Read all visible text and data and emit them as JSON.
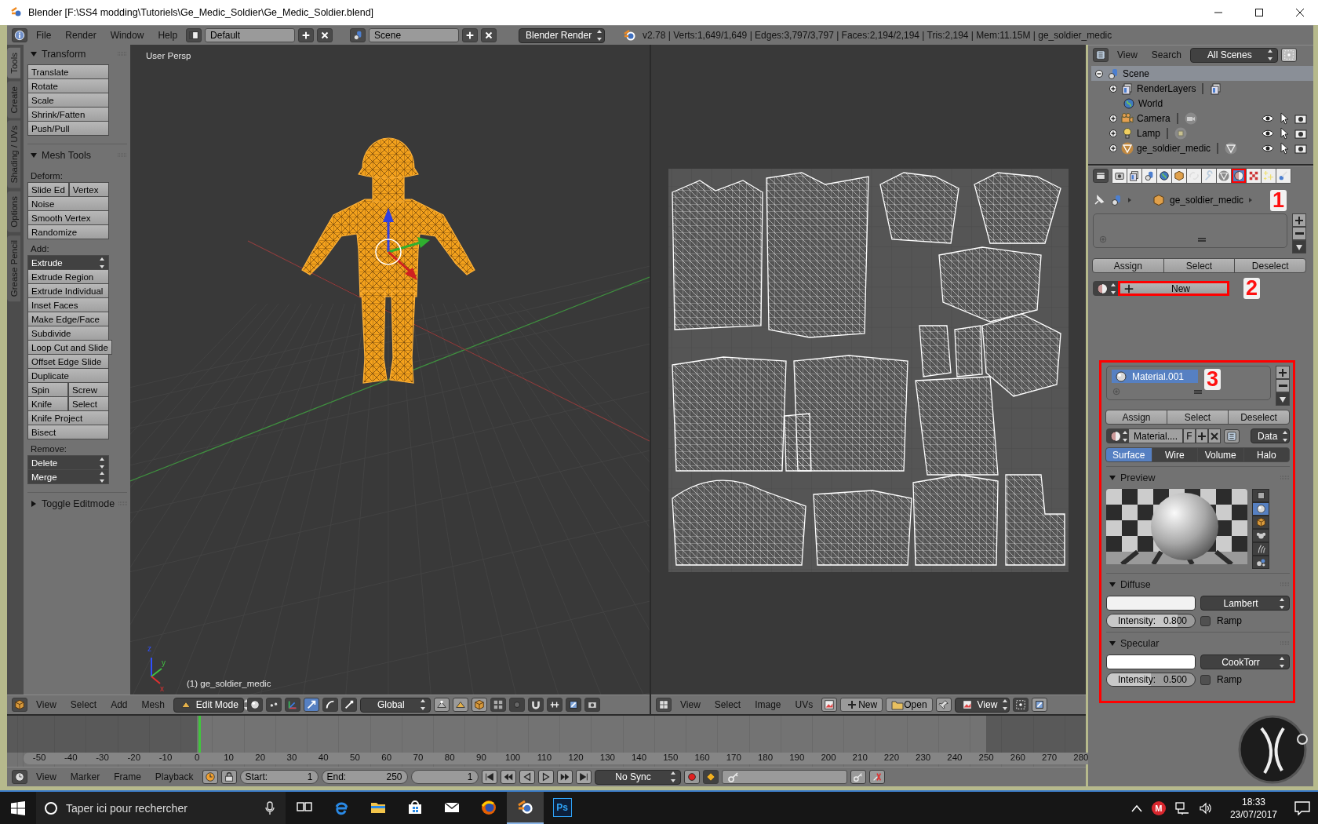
{
  "window": {
    "title": "Blender [F:\\SS4 modding\\Tutoriels\\Ge_Medic_Soldier\\Ge_Medic_Soldier.blend]"
  },
  "info_header": {
    "menus": [
      "File",
      "Render",
      "Window",
      "Help"
    ],
    "screen_layout": "Default",
    "scene": "Scene",
    "render_engine": "Blender Render",
    "stats": "v2.78 | Verts:1,649/1,649 | Edges:3,797/3,797 | Faces:2,194/2,194 | Tris:2,194 | Mem:11.15M | ge_soldier_medic"
  },
  "tool_tabs": [
    {
      "label": "Tools",
      "selected": true
    },
    {
      "label": "Create",
      "selected": false
    },
    {
      "label": "Shading / UVs",
      "selected": false
    },
    {
      "label": "Options",
      "selected": false
    },
    {
      "label": "Grease Pencil",
      "selected": false
    }
  ],
  "tool_panels": [
    {
      "title": "Transform",
      "expanded": true,
      "items": [
        {
          "kind": "buttons",
          "labels": [
            "Translate"
          ]
        },
        {
          "kind": "buttons",
          "labels": [
            "Rotate"
          ]
        },
        {
          "kind": "buttons",
          "labels": [
            "Scale"
          ]
        },
        {
          "kind": "buttons",
          "labels": [
            "Shrink/Fatten"
          ]
        },
        {
          "kind": "buttons",
          "labels": [
            "Push/Pull"
          ]
        }
      ]
    },
    {
      "title": "Mesh Tools",
      "expanded": true,
      "items": [
        {
          "kind": "label",
          "text": "Deform:"
        },
        {
          "kind": "buttons",
          "labels": [
            "Slide Ed",
            "Vertex"
          ]
        },
        {
          "kind": "buttons",
          "labels": [
            "Noise"
          ]
        },
        {
          "kind": "buttons",
          "labels": [
            "Smooth Vertex"
          ]
        },
        {
          "kind": "buttons",
          "labels": [
            "Randomize"
          ]
        },
        {
          "kind": "label",
          "text": "Add:"
        },
        {
          "kind": "dropdown",
          "labels": [
            "Extrude"
          ]
        },
        {
          "kind": "buttons",
          "labels": [
            "Extrude Region"
          ]
        },
        {
          "kind": "buttons",
          "labels": [
            "Extrude Individual"
          ]
        },
        {
          "kind": "buttons",
          "labels": [
            "Inset Faces"
          ]
        },
        {
          "kind": "buttons",
          "labels": [
            "Make Edge/Face"
          ]
        },
        {
          "kind": "buttons",
          "labels": [
            "Subdivide"
          ]
        },
        {
          "kind": "buttons",
          "labels": [
            "Loop Cut and Slide"
          ]
        },
        {
          "kind": "buttons",
          "labels": [
            "Offset Edge Slide"
          ]
        },
        {
          "kind": "buttons",
          "labels": [
            "Duplicate"
          ]
        },
        {
          "kind": "buttons",
          "labels": [
            "Spin",
            "Screw"
          ]
        },
        {
          "kind": "buttons",
          "labels": [
            "Knife",
            "Select"
          ]
        },
        {
          "kind": "buttons",
          "labels": [
            "Knife Project"
          ]
        },
        {
          "kind": "buttons",
          "labels": [
            "Bisect"
          ]
        },
        {
          "kind": "label",
          "text": "Remove:"
        },
        {
          "kind": "dropdown",
          "labels": [
            "Delete"
          ]
        },
        {
          "kind": "dropdown",
          "labels": [
            "Merge"
          ]
        }
      ]
    },
    {
      "title": "Toggle Editmode",
      "expanded": false
    }
  ],
  "viewport": {
    "view_name": "User Persp",
    "object_name": "(1) ge_soldier_medic",
    "axis_labels": [
      "z",
      "y",
      "x"
    ],
    "header": {
      "menus": [
        "View",
        "Select",
        "Add",
        "Mesh"
      ],
      "mode": "Edit Mode",
      "orientation": "Global"
    }
  },
  "uv_editor": {
    "header": {
      "menus": [
        "View",
        "Select",
        "Image",
        "UVs"
      ],
      "new_label": "New",
      "open_label": "Open",
      "view_label": "View"
    }
  },
  "timeline": {
    "frame_labels": [
      "-50",
      "-40",
      "-30",
      "-20",
      "-10",
      "0",
      "10",
      "20",
      "30",
      "40",
      "50",
      "60",
      "70",
      "80",
      "90",
      "100",
      "110",
      "120",
      "130",
      "140",
      "150",
      "160",
      "170",
      "180",
      "190",
      "200",
      "210",
      "220",
      "230",
      "240",
      "250",
      "260",
      "270",
      "280"
    ],
    "header": {
      "menus": [
        "View",
        "Marker",
        "Frame",
        "Playback"
      ],
      "start_label": "Start:",
      "start": "1",
      "end_label": "End:",
      "end": "250",
      "current_frame": "1",
      "sync": "No Sync"
    }
  },
  "outliner": {
    "header": {
      "menus": [
        "View",
        "Search"
      ],
      "display": "All Scenes"
    },
    "tree": [
      {
        "label": "Scene",
        "kind": "scene",
        "expanded": true,
        "selected": true,
        "children": [
          {
            "label": "RenderLayers",
            "kind": "renderlayers",
            "expanded": false,
            "selected": false
          },
          {
            "label": "World",
            "kind": "world",
            "selected": false
          },
          {
            "label": "Camera",
            "kind": "camera",
            "expanded": false,
            "selected": false
          },
          {
            "label": "Lamp",
            "kind": "lamp",
            "expanded": false,
            "selected": false
          },
          {
            "label": "ge_soldier_medic",
            "kind": "mesh",
            "expanded": false,
            "selected": false
          }
        ]
      }
    ]
  },
  "properties": {
    "tabs": [
      {
        "kind": "render",
        "selected": false,
        "annotated": false
      },
      {
        "kind": "layers",
        "selected": false,
        "annotated": false
      },
      {
        "kind": "scene",
        "selected": false,
        "annotated": false
      },
      {
        "kind": "world",
        "selected": false,
        "annotated": false
      },
      {
        "kind": "object",
        "selected": false,
        "annotated": false
      },
      {
        "kind": "constraints",
        "selected": false,
        "annotated": false
      },
      {
        "kind": "modifiers",
        "selected": false,
        "annotated": false
      },
      {
        "kind": "data",
        "selected": false,
        "annotated": false
      },
      {
        "kind": "material",
        "selected": true,
        "annotated": true
      },
      {
        "kind": "texture",
        "selected": false,
        "annotated": false
      },
      {
        "kind": "particles",
        "selected": false,
        "annotated": false
      },
      {
        "kind": "physics",
        "selected": false,
        "annotated": false
      }
    ],
    "context": {
      "object": "ge_soldier_medic",
      "annotation": "1"
    },
    "slot_buttons": [
      "Assign",
      "Select",
      "Deselect"
    ],
    "new_button": {
      "label": "New",
      "annotated": true,
      "annotation": "2"
    },
    "material_section": {
      "annotated": true,
      "annotation": "3",
      "slots": [
        {
          "name": "Material.001",
          "selected": true
        }
      ],
      "slot_buttons": [
        "Assign",
        "Select",
        "Deselect"
      ],
      "datablock": {
        "name": "Material....",
        "fake_user": "F",
        "link": "Data"
      },
      "shading_tabs": [
        {
          "label": "Surface",
          "selected": true
        },
        {
          "label": "Wire",
          "selected": false
        },
        {
          "label": "Volume",
          "selected": false
        },
        {
          "label": "Halo",
          "selected": false
        }
      ],
      "panels": [
        {
          "kind": "preview",
          "title": "Preview",
          "expanded": true,
          "shapes": [
            {
              "kind": "plane",
              "selected": false
            },
            {
              "kind": "sphere",
              "selected": true
            },
            {
              "kind": "cube",
              "selected": false
            },
            {
              "kind": "monkey",
              "selected": false
            },
            {
              "kind": "hair",
              "selected": false
            },
            {
              "kind": "spheres",
              "selected": false
            }
          ]
        },
        {
          "kind": "shader",
          "title": "Diffuse",
          "expanded": true,
          "color": "#f2f2f2",
          "shader": "Lambert",
          "intensity_label": "Intensity:",
          "intensity": "0.800",
          "level": 0.8,
          "ramp_label": "Ramp",
          "ramp": false
        },
        {
          "kind": "shader",
          "title": "Specular",
          "expanded": true,
          "color": "#ffffff",
          "shader": "CookTorr",
          "intensity_label": "Intensity:",
          "intensity": "0.500",
          "level": 0.5,
          "ramp_label": "Ramp",
          "ramp": false
        }
      ]
    }
  },
  "taskbar": {
    "search_placeholder": "Taper ici pour rechercher",
    "apps": [
      {
        "kind": "task-view",
        "selected": false
      },
      {
        "kind": "edge",
        "selected": false
      },
      {
        "kind": "explorer",
        "selected": false
      },
      {
        "kind": "store",
        "selected": false
      },
      {
        "kind": "mail",
        "selected": false
      },
      {
        "kind": "firefox",
        "selected": false
      },
      {
        "kind": "blender",
        "selected": true
      },
      {
        "kind": "photoshop",
        "label": "Ps",
        "selected": false
      }
    ],
    "tray_badge": "M",
    "time": "18:33",
    "date": "23/07/2017"
  }
}
